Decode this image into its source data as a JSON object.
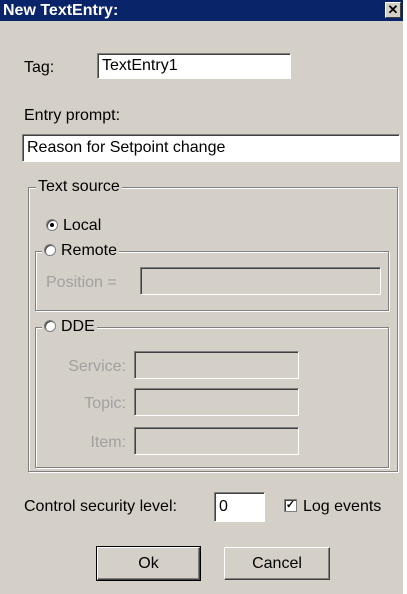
{
  "window": {
    "title": "New TextEntry:",
    "close_glyph": "✕"
  },
  "tag": {
    "label": "Tag:",
    "value": "TextEntry1"
  },
  "entry_prompt": {
    "label": "Entry prompt:",
    "value": "Reason for Setpoint change"
  },
  "text_source": {
    "label": "Text source",
    "local_label": "Local",
    "remote": {
      "label": "Remote",
      "position_label": "Position =",
      "position_value": ""
    },
    "dde": {
      "label": "DDE",
      "service_label": "Service:",
      "service_value": "",
      "topic_label": "Topic:",
      "topic_value": "",
      "item_label": "Item:",
      "item_value": ""
    },
    "selected": "Local"
  },
  "security": {
    "label": "Control security level:",
    "value": "0"
  },
  "log_events": {
    "label": "Log events",
    "checked": true,
    "check_glyph": "✓"
  },
  "buttons": {
    "ok": "Ok",
    "cancel": "Cancel"
  },
  "colors": {
    "face": "#d4d0c8",
    "titlebar": "#0a246a",
    "disabled_text": "#a0a0a0"
  }
}
